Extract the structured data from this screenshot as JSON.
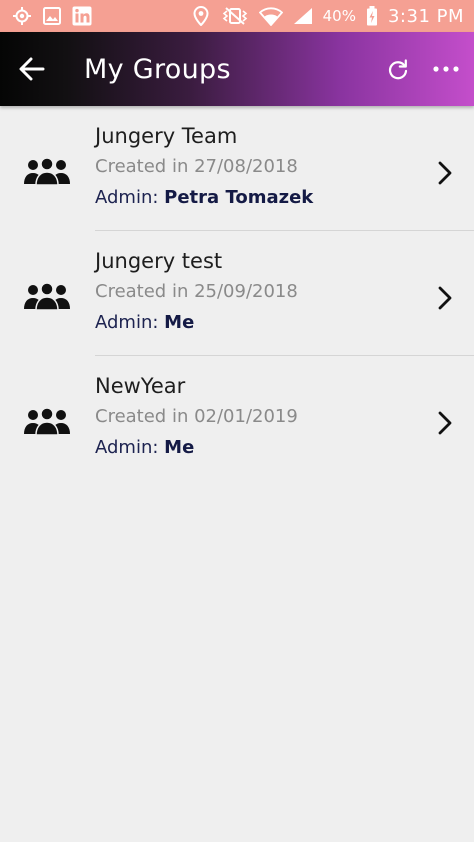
{
  "status_bar": {
    "battery_percent": "40%",
    "time": "3:31 PM",
    "left_icons": [
      "gps-icon",
      "image-icon",
      "linkedin-icon"
    ],
    "right_icons": [
      "location-icon",
      "vibrate-icon",
      "wifi-icon",
      "signal-icon",
      "battery-charging-icon"
    ]
  },
  "app_bar": {
    "title": "My Groups",
    "icons": [
      "back-arrow-icon",
      "refresh-icon",
      "more-icon"
    ]
  },
  "groups": [
    {
      "name": "Jungery Team",
      "created": "Created in 27/08/2018",
      "admin_label": "Admin: ",
      "admin_name": "Petra Tomazek"
    },
    {
      "name": "Jungery test",
      "created": "Created in 25/09/2018",
      "admin_label": "Admin: ",
      "admin_name": "Me"
    },
    {
      "name": "NewYear",
      "created": "Created in 02/01/2019",
      "admin_label": "Admin: ",
      "admin_name": "Me"
    }
  ],
  "colors": {
    "status_bar": "#f5a093",
    "app_bar_start": "#050505",
    "app_bar_end": "#c44ecb",
    "background": "#efefef",
    "admin_name": "#141a45"
  }
}
